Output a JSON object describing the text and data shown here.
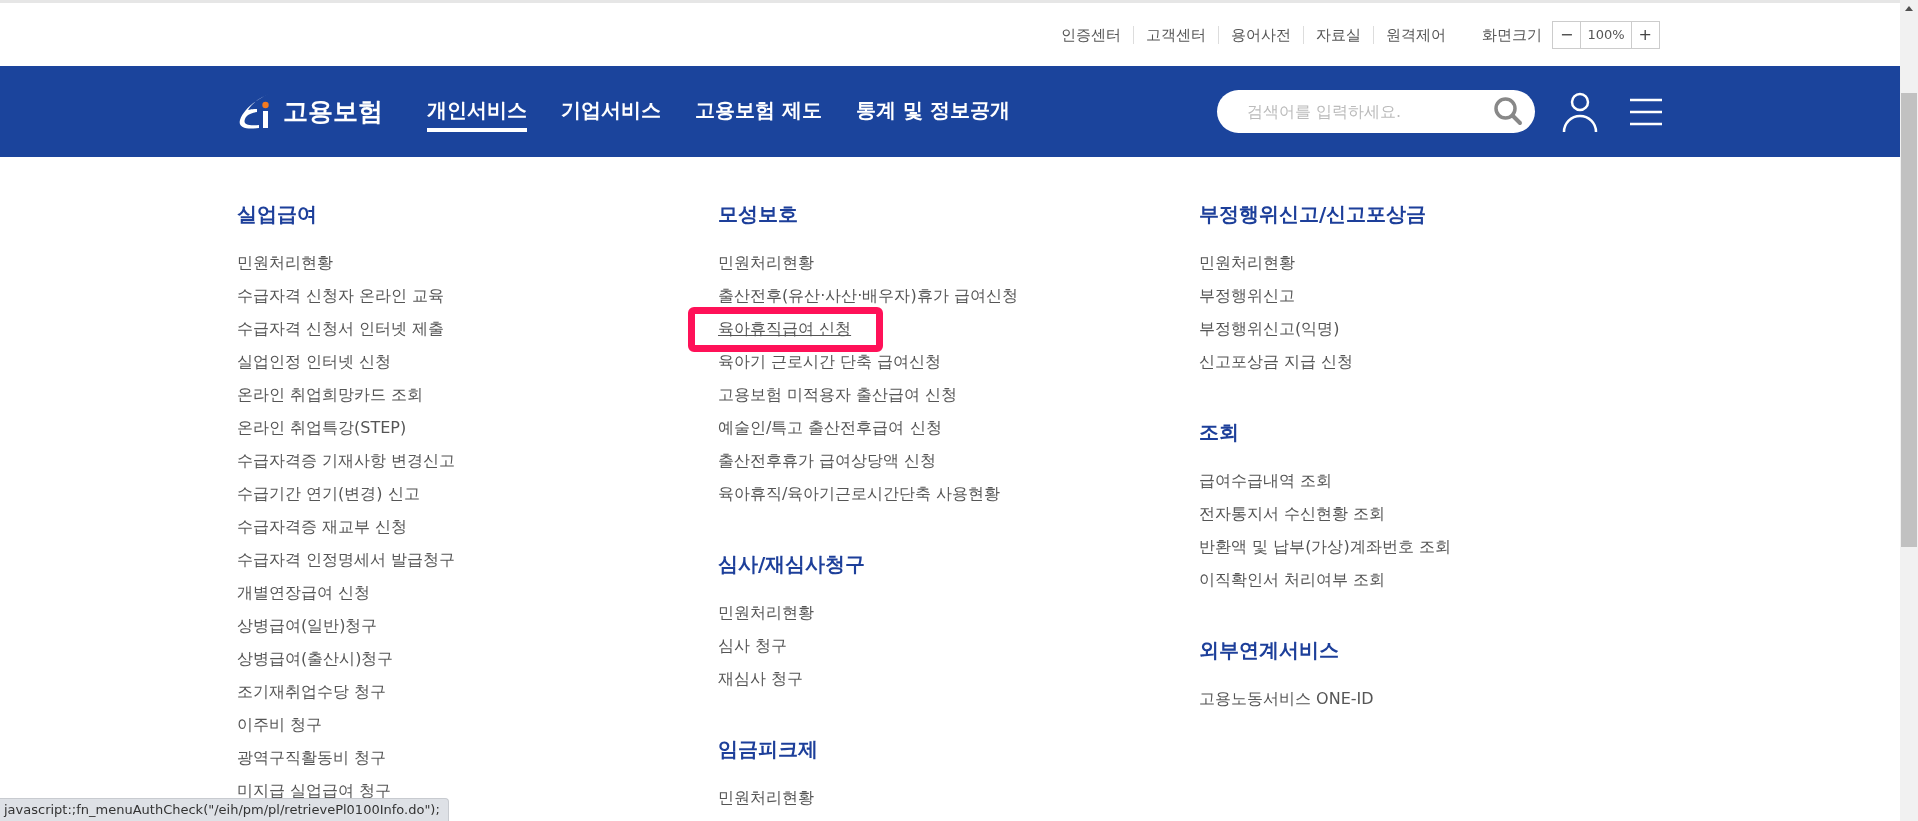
{
  "utility_links": [
    {
      "label": "인증센터"
    },
    {
      "label": "고객센터"
    },
    {
      "label": "용어사전"
    },
    {
      "label": "자료실"
    }
  ],
  "remote_control": "원격제어",
  "screen_size": {
    "label": "화면크기",
    "decrease": "−",
    "value": "100%",
    "increase": "+"
  },
  "header": {
    "logo_text": "고용보험",
    "nav": [
      {
        "label": "개인서비스",
        "selected": true
      },
      {
        "label": "기업서비스",
        "selected": false
      },
      {
        "label": "고용보험 제도",
        "selected": false
      },
      {
        "label": "통계 및 정보공개",
        "selected": false
      }
    ],
    "search": {
      "placeholder": "검색어를 입력하세요."
    }
  },
  "menu": {
    "columns": [
      {
        "sections": [
          {
            "title": "실업급여",
            "items": [
              {
                "label": "민원처리현황",
                "highlighted": false
              },
              {
                "label": "수급자격 신청자 온라인 교육",
                "highlighted": false
              },
              {
                "label": "수급자격 신청서 인터넷 제출",
                "highlighted": false
              },
              {
                "label": "실업인정 인터넷 신청",
                "highlighted": false
              },
              {
                "label": "온라인 취업희망카드 조회",
                "highlighted": false
              },
              {
                "label": "온라인 취업특강(STEP)",
                "highlighted": false
              },
              {
                "label": "수급자격증 기재사항 변경신고",
                "highlighted": false
              },
              {
                "label": "수급기간 연기(변경) 신고",
                "highlighted": false
              },
              {
                "label": "수급자격증 재교부 신청",
                "highlighted": false
              },
              {
                "label": "수급자격 인정명세서 발급청구",
                "highlighted": false
              },
              {
                "label": "개별연장급여 신청",
                "highlighted": false
              },
              {
                "label": "상병급여(일반)청구",
                "highlighted": false
              },
              {
                "label": "상병급여(출산시)청구",
                "highlighted": false
              },
              {
                "label": "조기재취업수당 청구",
                "highlighted": false
              },
              {
                "label": "이주비 청구",
                "highlighted": false
              },
              {
                "label": "광역구직활동비 청구",
                "highlighted": false
              },
              {
                "label": "미지급 실업급여 청구",
                "highlighted": false
              }
            ]
          }
        ]
      },
      {
        "sections": [
          {
            "title": "모성보호",
            "items": [
              {
                "label": "민원처리현황",
                "highlighted": false
              },
              {
                "label": "출산전후(유산·사산·배우자)휴가 급여신청",
                "highlighted": false
              },
              {
                "label": "육아휴직급여 신청",
                "highlighted": true
              },
              {
                "label": "육아기 근로시간 단축 급여신청",
                "highlighted": false
              },
              {
                "label": "고용보험 미적용자 출산급여 신청",
                "highlighted": false
              },
              {
                "label": "예술인/특고 출산전후급여 신청",
                "highlighted": false
              },
              {
                "label": "출산전후휴가 급여상당액 신청",
                "highlighted": false
              },
              {
                "label": "육아휴직/육아기근로시간단축 사용현황",
                "highlighted": false
              }
            ]
          },
          {
            "title": "심사/재심사청구",
            "items": [
              {
                "label": "민원처리현황",
                "highlighted": false
              },
              {
                "label": "심사 청구",
                "highlighted": false
              },
              {
                "label": "재심사 청구",
                "highlighted": false
              }
            ]
          },
          {
            "title": "임금피크제",
            "items": [
              {
                "label": "민원처리현황",
                "highlighted": false
              }
            ]
          }
        ]
      },
      {
        "sections": [
          {
            "title": "부정행위신고/신고포상금",
            "items": [
              {
                "label": "민원처리현황",
                "highlighted": false
              },
              {
                "label": "부정행위신고",
                "highlighted": false
              },
              {
                "label": "부정행위신고(익명)",
                "highlighted": false
              },
              {
                "label": "신고포상금 지급 신청",
                "highlighted": false
              }
            ]
          },
          {
            "title": "조회",
            "items": [
              {
                "label": "급여수급내역 조회",
                "highlighted": false
              },
              {
                "label": "전자통지서 수신현황 조회",
                "highlighted": false
              },
              {
                "label": "반환액 및 납부(가상)계좌번호 조회",
                "highlighted": false
              },
              {
                "label": "이직확인서 처리여부 조회",
                "highlighted": false
              }
            ]
          },
          {
            "title": "외부연계서비스",
            "items": [
              {
                "label": "고용노동서비스 ONE-ID",
                "highlighted": false
              }
            ]
          }
        ]
      }
    ]
  },
  "status_bar": {
    "text": "javascript:;fn_menuAuthCheck(\"/eih/pm/pl/retrievePl0100Info.do\");"
  }
}
